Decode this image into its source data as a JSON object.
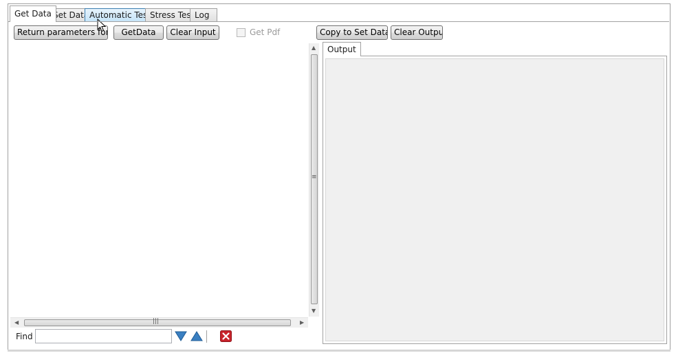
{
  "tabs": [
    {
      "label": "Get Data",
      "active": true
    },
    {
      "label": "Set Data",
      "active": false
    },
    {
      "label": "Automatic Tests",
      "active": false,
      "hover": true
    },
    {
      "label": "Stress Test",
      "active": false
    },
    {
      "label": "Log",
      "active": false
    }
  ],
  "toolbar": {
    "return_params_label": "Return parameters for find",
    "get_data_label": "GetData",
    "clear_input_label": "Clear Input",
    "get_pdf_label": "Get Pdf",
    "get_pdf_checked": false,
    "copy_to_set_label": "Copy to Set Data",
    "clear_output_label": "Clear Output"
  },
  "input": {
    "value": ""
  },
  "find": {
    "label": "Find",
    "value": "",
    "next_icon": "arrow-down-icon",
    "prev_icon": "arrow-up-icon",
    "clear_icon": "close-icon"
  },
  "output": {
    "tab_label": "Output",
    "value": ""
  },
  "colors": {
    "arrow_blue": "#3a7fc1",
    "close_red": "#c8232b",
    "hover_tab": "#c6e4f8"
  }
}
